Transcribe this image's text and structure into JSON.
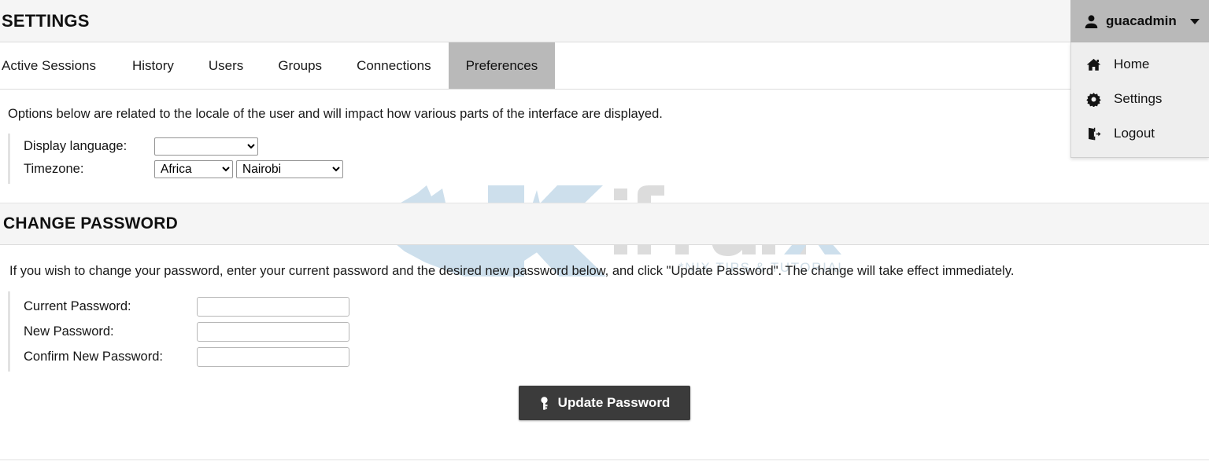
{
  "header": {
    "title": "SETTINGS"
  },
  "user_menu": {
    "username": "guacadmin",
    "avatar_icon": "user-icon",
    "caret_icon": "chevron-down-icon",
    "items": [
      {
        "label": "Home",
        "icon": "home-icon"
      },
      {
        "label": "Settings",
        "icon": "gear-icon"
      },
      {
        "label": "Logout",
        "icon": "logout-icon"
      }
    ]
  },
  "tabs": [
    {
      "label": "Active Sessions",
      "active": false
    },
    {
      "label": "History",
      "active": false
    },
    {
      "label": "Users",
      "active": false
    },
    {
      "label": "Groups",
      "active": false
    },
    {
      "label": "Connections",
      "active": false
    },
    {
      "label": "Preferences",
      "active": true
    }
  ],
  "preferences": {
    "description": "Options below are related to the locale of the user and will impact how various parts of the interface are displayed.",
    "display_language": {
      "label": "Display language:",
      "value": "",
      "options": [
        ""
      ]
    },
    "timezone": {
      "label": "Timezone:",
      "region_value": "Africa",
      "region_options": [
        "Africa"
      ],
      "city_value": "Nairobi",
      "city_options": [
        "Nairobi"
      ]
    }
  },
  "change_password": {
    "title": "CHANGE PASSWORD",
    "description": "If you wish to change your password, enter your current password and the desired new password below, and click \"Update Password\". The change will take effect immediately.",
    "fields": [
      {
        "label": "Current Password:",
        "value": "",
        "placeholder": ""
      },
      {
        "label": "New Password:",
        "value": "",
        "placeholder": ""
      },
      {
        "label": "Confirm New Password:",
        "value": "",
        "placeholder": ""
      }
    ],
    "submit_label": "Update Password",
    "submit_icon": "key-icon"
  },
  "watermark": {
    "text": "Kifarunix",
    "tagline": "*NIX TIPS & TUTORIALS",
    "color": "#ccdce8"
  },
  "colors": {
    "header_bg": "#f5f5f5",
    "active_tab_bg": "#b9b9b9",
    "menu_bg": "#eeeeee",
    "button_bg": "#3b3b3b",
    "page_bg": "#ffffff"
  }
}
